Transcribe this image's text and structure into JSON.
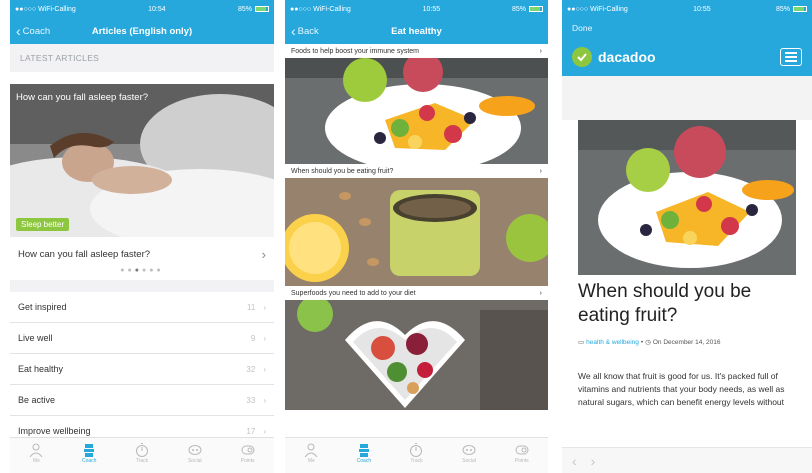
{
  "phone1": {
    "status": {
      "carrier": "●●○○○ WiFi-Calling",
      "time": "10:54",
      "battery": "85%",
      "battery_level": 0.85
    },
    "nav": {
      "back": "Coach",
      "title": "Articles (English only)"
    },
    "section_label": "LATEST ARTICLES",
    "hero": {
      "caption": "How can you fall asleep faster?",
      "tag": "Sleep better"
    },
    "article_link": "How can you fall asleep faster?",
    "categories": [
      {
        "label": "Get inspired",
        "count": "11"
      },
      {
        "label": "Live well",
        "count": "9"
      },
      {
        "label": "Eat healthy",
        "count": "32"
      },
      {
        "label": "Be active",
        "count": "33"
      },
      {
        "label": "Improve wellbeing",
        "count": "17"
      }
    ],
    "tabs": [
      "Me",
      "Coach",
      "Track",
      "Social",
      "Points"
    ]
  },
  "phone2": {
    "status": {
      "carrier": "●●○○○ WiFi-Calling",
      "time": "10:55",
      "battery": "85%",
      "battery_level": 0.85
    },
    "nav": {
      "back": "Back",
      "title": "Eat healthy"
    },
    "items": [
      {
        "label": "Foods to help boost your immune system"
      },
      {
        "label": "When should you be eating fruit?"
      },
      {
        "label": "Superfoods you need to add to your diet"
      }
    ],
    "tabs": [
      "Me",
      "Coach",
      "Track",
      "Social",
      "Points"
    ]
  },
  "phone3": {
    "status": {
      "carrier": "●●○○○ WiFi-Calling",
      "time": "10:55",
      "battery": "85%",
      "battery_level": 0.85
    },
    "done": "Done",
    "brand": "dacadoo",
    "title": "When should you be eating fruit?",
    "meta": {
      "category": "health & wellbeing",
      "date": "On December 14, 2016"
    },
    "body": "We all know that fruit is good for us. It's packed full of vitamins and nutrients that your body needs, as well as natural sugars, which can benefit energy levels without"
  },
  "colors": {
    "header": "#27a8dd",
    "accent_green": "#8dc63f"
  }
}
